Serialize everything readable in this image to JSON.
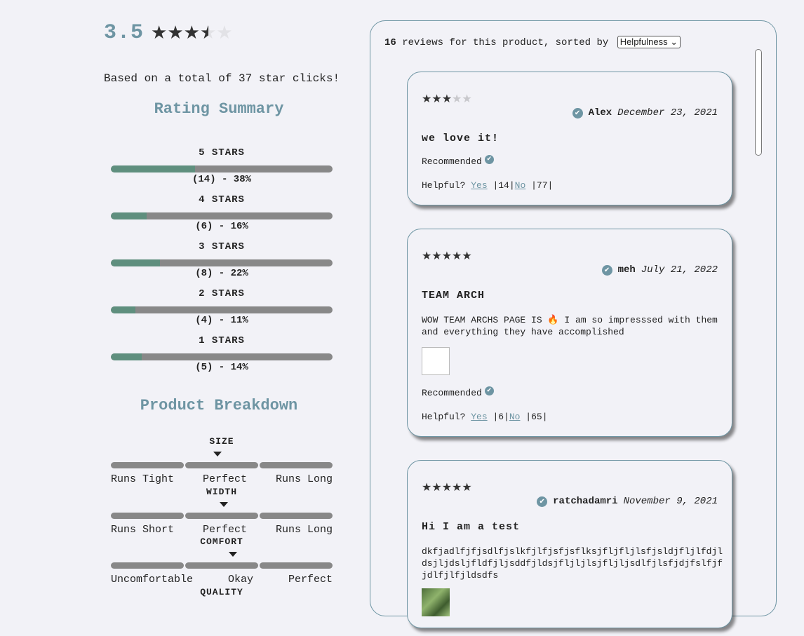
{
  "summary": {
    "average": "3.5",
    "average_value": 3.5,
    "star_icons": "★★★★★",
    "based_on": "Based on a total of 37 star clicks!"
  },
  "rating_summary": {
    "title": "Rating Summary",
    "bars": [
      {
        "label": "5 STARS",
        "count_text": "(14) - 38%",
        "percent": 38
      },
      {
        "label": "4 STARS",
        "count_text": "(6) - 16%",
        "percent": 16
      },
      {
        "label": "3 STARS",
        "count_text": "(8) - 22%",
        "percent": 22
      },
      {
        "label": "2 STARS",
        "count_text": "(4) - 11%",
        "percent": 11
      },
      {
        "label": "1 STARS",
        "count_text": "(5) - 14%",
        "percent": 14
      }
    ]
  },
  "product_breakdown": {
    "title": "Product Breakdown",
    "factors": [
      {
        "name": "SIZE",
        "labels": [
          "Runs Tight",
          "Perfect",
          "Runs Long"
        ],
        "marker_fraction": 0.48
      },
      {
        "name": "WIDTH",
        "labels": [
          "Runs Short",
          "Perfect",
          "Runs Long"
        ],
        "marker_fraction": 0.51
      },
      {
        "name": "COMFORT",
        "labels": [
          "Uncomfortable",
          "Okay",
          "Perfect"
        ],
        "marker_fraction": 0.55
      },
      {
        "name": "QUALITY",
        "labels": [],
        "marker_fraction": null
      }
    ]
  },
  "reviews_panel": {
    "count": "16",
    "sort_text": "reviews for this product, sorted by",
    "sort_value": "Helpfulness",
    "sort_arrow": "⌄"
  },
  "reviews": [
    {
      "stars_on": "★★★",
      "stars_off": "★★",
      "reviewer": "Alex",
      "date": "December 23, 2021",
      "summary": "we love it!",
      "body": "",
      "recommended": "Recommended",
      "helpful_label": "Helpful?",
      "yes_label": "Yes",
      "yes_count": "14",
      "no_label": "No",
      "no_count": "77"
    },
    {
      "stars_on": "★★★★★",
      "stars_off": "",
      "reviewer": "meh",
      "date": "July 21, 2022",
      "summary": "TEAM ARCH",
      "body": "WOW TEAM ARCHS PAGE IS 🔥 I am so impresssed with them and everything they have accomplished",
      "recommended": "Recommended",
      "helpful_label": "Helpful?",
      "yes_label": "Yes",
      "yes_count": "6",
      "no_label": "No",
      "no_count": "65"
    },
    {
      "stars_on": "★★★★★",
      "stars_off": "",
      "reviewer": "ratchadamri",
      "date": "November 9, 2021",
      "summary": "Hi I am a test",
      "body": "dkfjadlfjfjsdlfjslkfjlfjsfjsflksjfljfljlsfjsldjfljlfdjldsjljdsljfldfjljsddfjldsjfljljlsjfljljsdlfjlsfjdjfslfjfjdlfjlfjldsdfs",
      "recommended": "",
      "helpful_label": "",
      "yes_label": "",
      "yes_count": "",
      "no_label": "",
      "no_count": ""
    }
  ],
  "icons": {
    "verified": "✔",
    "accent_color": "#6e95a3",
    "bar_fill_color": "#5f8f7e"
  }
}
